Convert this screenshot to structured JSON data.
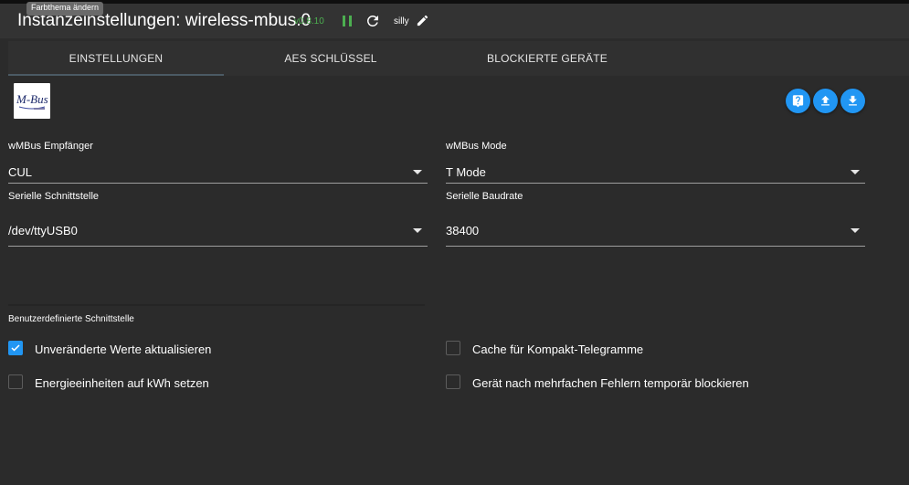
{
  "header": {
    "title": "Instanzeinstellungen: wireless-mbus.0",
    "version": "v0.8.10",
    "log_level": "silly",
    "tooltip": "Farbthema ändern",
    "icons": [
      "pause-icon",
      "reload-icon",
      "edit-icon"
    ]
  },
  "tabs": [
    {
      "label": "EINSTELLUNGEN",
      "active": true
    },
    {
      "label": "AES SCHLÜSSEL",
      "active": false
    },
    {
      "label": "BLOCKIERTE GERÄTE",
      "active": false
    }
  ],
  "logo": {
    "text_top": "M-Bus"
  },
  "actions": [
    "help-icon",
    "upload-icon",
    "download-icon"
  ],
  "form": {
    "receiver": {
      "label": "wMBus Empfänger",
      "value": "CUL"
    },
    "mode": {
      "label": "wMBus Mode",
      "value": "T Mode"
    },
    "serial_port": {
      "label": "Serielle Schnittstelle",
      "value": "/dev/ttyUSB0"
    },
    "baudrate": {
      "label": "Serielle Baudrate",
      "value": "38400"
    },
    "custom_port": {
      "label": "Benutzerdefinierte Schnittstelle"
    },
    "checkboxes": {
      "update_unchanged": {
        "label": "Unveränderte Werte aktualisieren",
        "checked": true
      },
      "compact_cache": {
        "label": "Cache für Kompakt-Telegramme",
        "checked": false
      },
      "energy_kwh": {
        "label": "Energieeinheiten auf kWh setzen",
        "checked": false
      },
      "block_devices": {
        "label": "Gerät nach mehrfachen Fehlern temporär blockieren",
        "checked": false
      }
    }
  },
  "colors": {
    "accent": "#2196f3",
    "version": "#4caf50",
    "background": "#2b2b2b"
  }
}
